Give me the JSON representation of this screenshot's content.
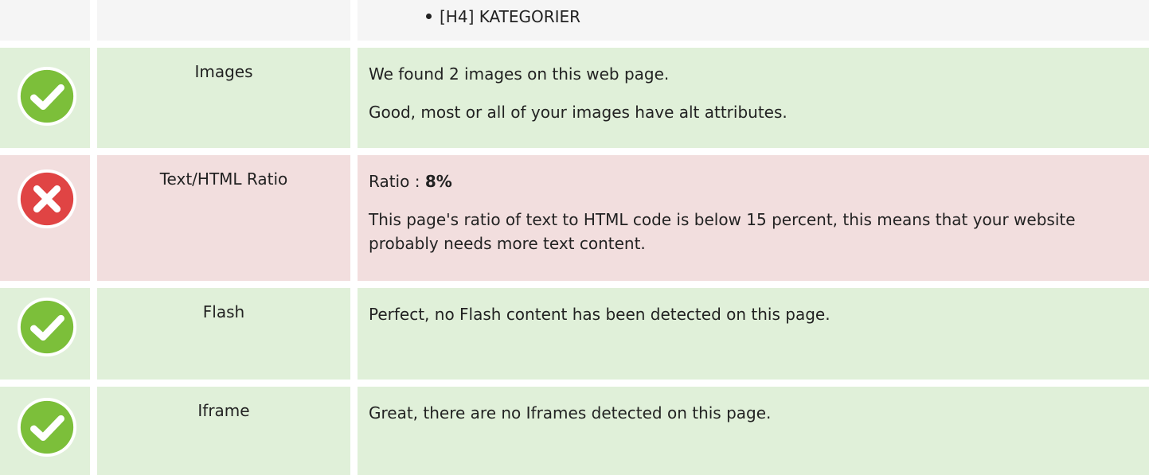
{
  "top": {
    "item": "[H4] KATEGORIER"
  },
  "rows": [
    {
      "status": "pass",
      "name": "Images",
      "lines": [
        "We found 2 images on this web page.",
        "Good, most or all of your images have alt attributes."
      ]
    },
    {
      "status": "fail",
      "name": "Text/HTML Ratio",
      "ratio_label": "Ratio : ",
      "ratio_value": "8%",
      "lines": [
        "This page's ratio of text to HTML code is below 15 percent, this means that your website probably needs more text content."
      ]
    },
    {
      "status": "pass",
      "name": "Flash",
      "lines": [
        "Perfect, no Flash content has been detected on this page."
      ]
    },
    {
      "status": "pass",
      "name": "Iframe",
      "lines": [
        "Great, there are no Iframes detected on this page."
      ]
    }
  ],
  "colors": {
    "pass_bg": "#e0f0d9",
    "fail_bg": "#f2dede",
    "pass_icon": "#7cbf3a",
    "fail_icon": "#e04444"
  }
}
